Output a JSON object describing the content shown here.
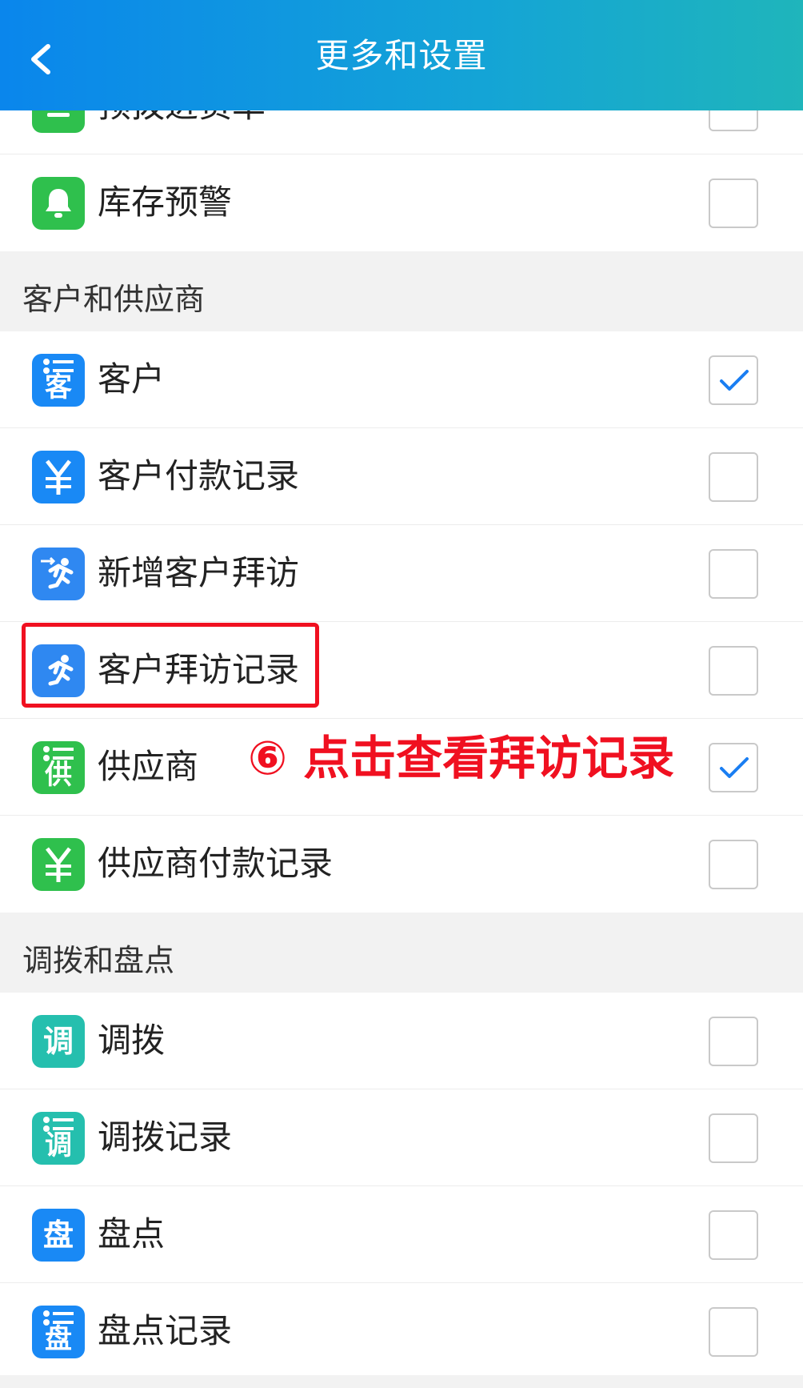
{
  "header": {
    "title": "更多和设置",
    "back_icon": "chevron-left-icon"
  },
  "sections": [
    {
      "title": "",
      "items": [
        {
          "label": "预拨进货单",
          "icon": "list-icon",
          "icon_text": "☰",
          "color": "green",
          "checked": false
        },
        {
          "label": "库存预警",
          "icon": "bell-icon",
          "icon_text": "🔔",
          "color": "green",
          "checked": false
        }
      ]
    },
    {
      "title": "客户和供应商",
      "items": [
        {
          "label": "客户",
          "icon": "customer-list-icon",
          "icon_text": "客",
          "color": "blue",
          "checked": true
        },
        {
          "label": "客户付款记录",
          "icon": "yuan-icon",
          "icon_text": "¥",
          "color": "blue",
          "checked": false
        },
        {
          "label": "新增客户拜访",
          "icon": "add-visit-icon",
          "icon_text": "🏃",
          "color": "blue2",
          "checked": false
        },
        {
          "label": "客户拜访记录",
          "icon": "visit-record-icon",
          "icon_text": "🏃",
          "color": "blue2",
          "checked": false
        },
        {
          "label": "供应商",
          "icon": "supplier-list-icon",
          "icon_text": "供",
          "color": "green",
          "checked": true
        },
        {
          "label": "供应商付款记录",
          "icon": "yuan-icon",
          "icon_text": "¥",
          "color": "green",
          "checked": false
        }
      ]
    },
    {
      "title": "调拨和盘点",
      "items": [
        {
          "label": "调拨",
          "icon": "transfer-icon",
          "icon_text": "调",
          "color": "teal",
          "checked": false
        },
        {
          "label": "调拨记录",
          "icon": "transfer-record-icon",
          "icon_text": "调",
          "color": "teal",
          "checked": false
        },
        {
          "label": "盘点",
          "icon": "inventory-icon",
          "icon_text": "盘",
          "color": "blue",
          "checked": false
        },
        {
          "label": "盘点记录",
          "icon": "inventory-record-icon",
          "icon_text": "盘",
          "color": "blue",
          "checked": false
        }
      ]
    }
  ],
  "annotation": {
    "text": "⑥ 点击查看拜访记录",
    "color": "#f01020"
  },
  "colors": {
    "header_start": "#0a86ec",
    "header_end": "#1fb5bb",
    "green": "#2fc04d",
    "blue": "#1989f5",
    "teal": "#25bfae",
    "check": "#1a7ef2"
  }
}
